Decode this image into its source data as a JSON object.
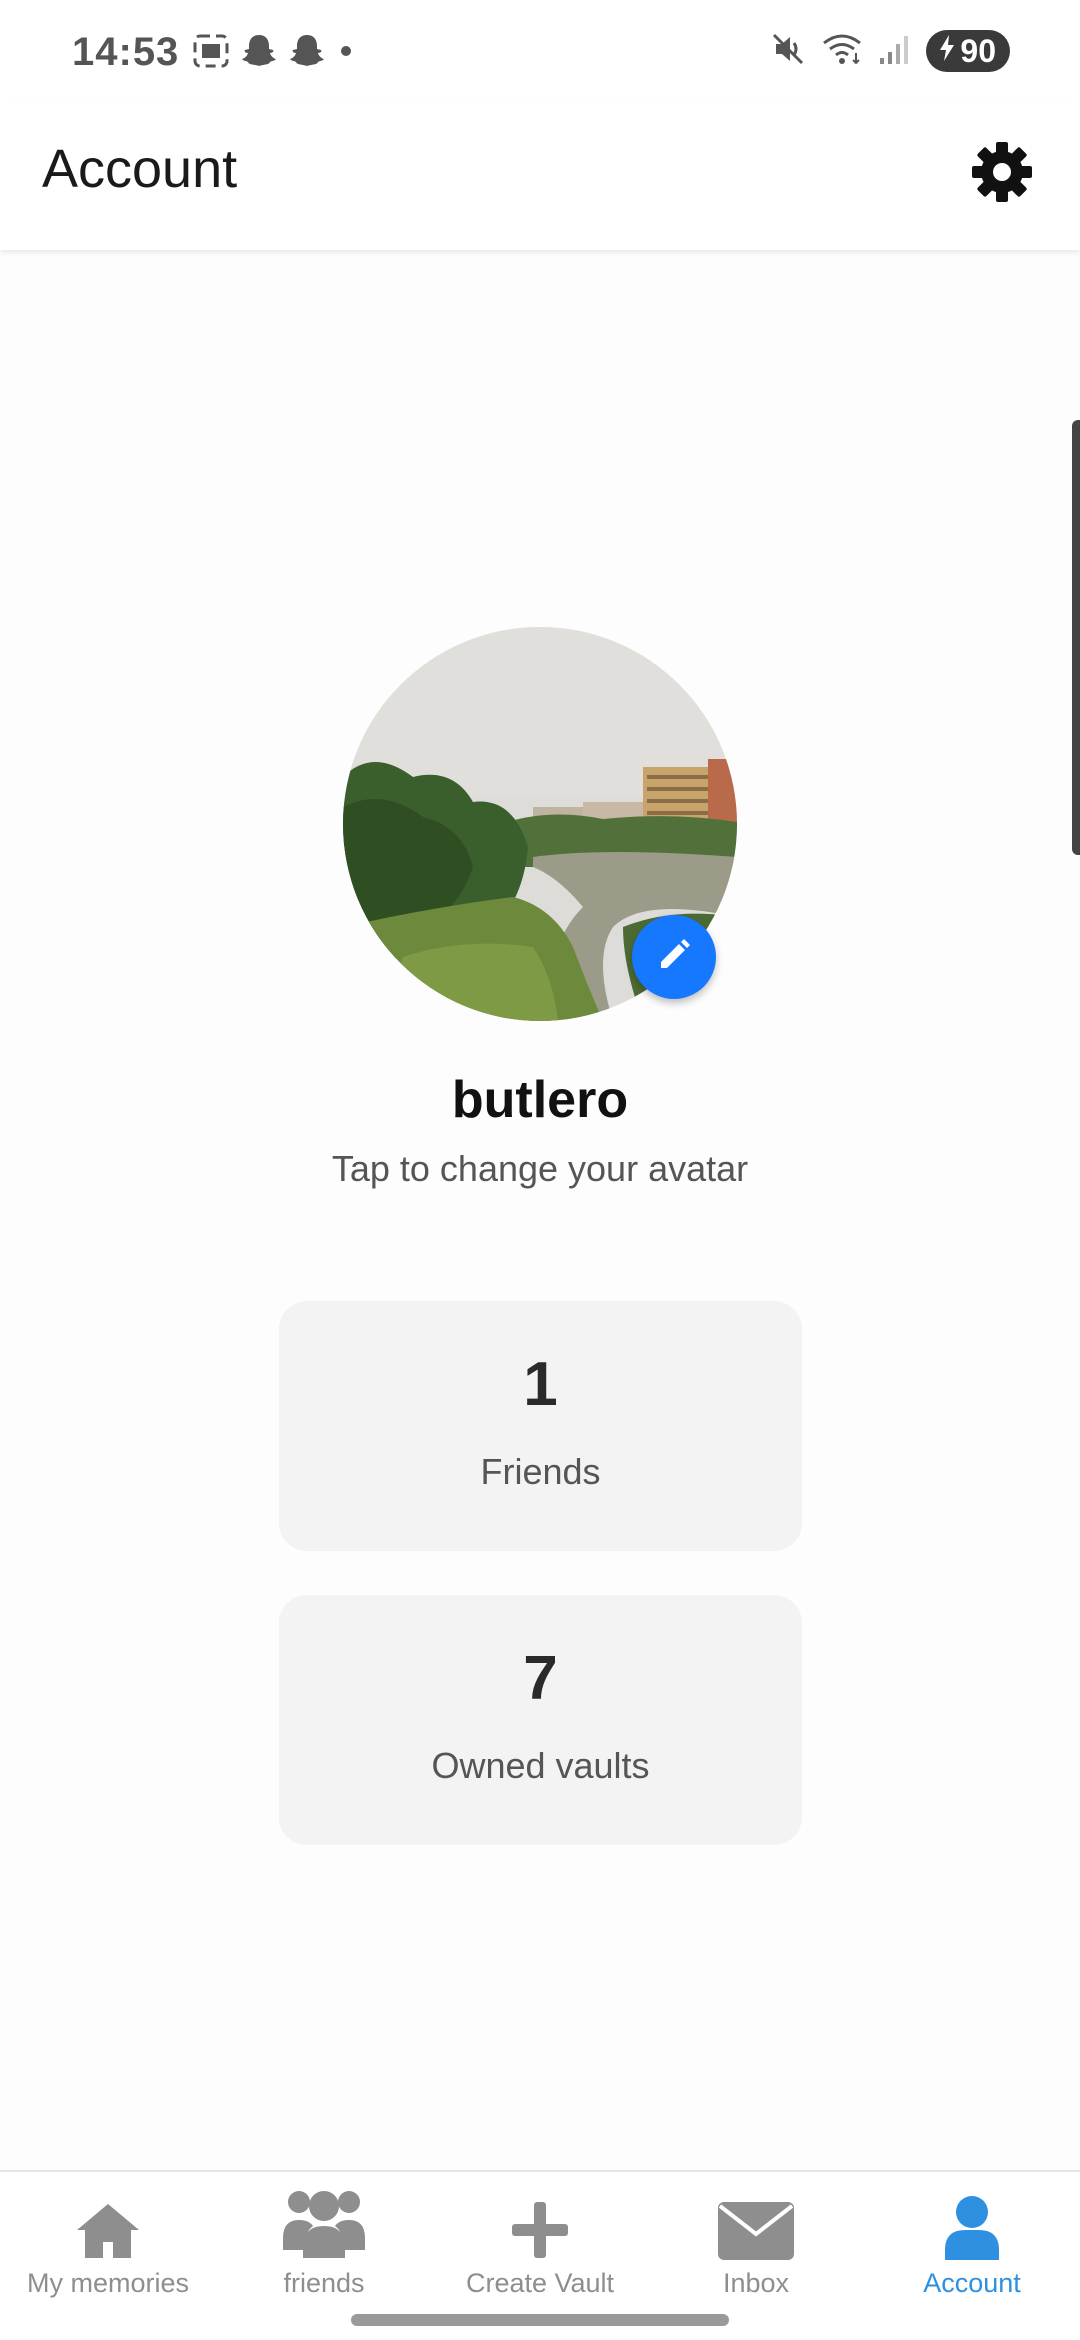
{
  "status_bar": {
    "time": "14:53",
    "battery": "90",
    "icons": [
      "screenshot-icon",
      "snapchat-icon",
      "snapchat-icon",
      "dot-icon",
      "mute-icon",
      "wifi-icon",
      "signal-icon",
      "battery-charging-icon"
    ]
  },
  "app_bar": {
    "title": "Account",
    "settings_icon": "gear-icon"
  },
  "profile": {
    "username": "butlero",
    "avatar_hint": "Tap to change your avatar",
    "edit_icon": "pencil-icon"
  },
  "stats": [
    {
      "value": "1",
      "label": "Friends"
    },
    {
      "value": "7",
      "label": "Owned vaults"
    }
  ],
  "bottom_nav": {
    "items": [
      {
        "label": "My memories",
        "icon": "home-icon",
        "active": false
      },
      {
        "label": "friends",
        "icon": "users-icon",
        "active": false
      },
      {
        "label": "Create Vault",
        "icon": "plus-icon",
        "active": false
      },
      {
        "label": "Inbox",
        "icon": "envelope-icon",
        "active": false
      },
      {
        "label": "Account",
        "icon": "user-icon",
        "active": true
      }
    ]
  },
  "colors": {
    "accent": "#2f8fe0",
    "edit_button": "#1677ff",
    "inactive_nav": "#8e8e8e",
    "card_bg": "#f3f3f3"
  }
}
